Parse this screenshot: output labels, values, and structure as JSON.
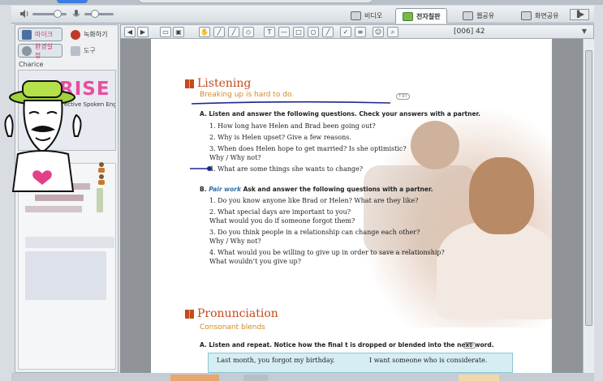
{
  "toolbar_tabs": [
    {
      "label": "비디오",
      "icon": "video-icon",
      "active": false
    },
    {
      "label": "전자칠판",
      "icon": "pen-icon",
      "active": true
    },
    {
      "label": "웹공유",
      "icon": "web-icon",
      "active": false
    },
    {
      "label": "화면공유",
      "icon": "monitor-icon",
      "active": false
    }
  ],
  "left_tools": {
    "mic": "마이크",
    "record": "녹화하기",
    "settings": "환경설정",
    "tools": "도구"
  },
  "section_title": "Charice",
  "video_logo": {
    "text": "RISE",
    "sub": "ective Spoken Englis"
  },
  "doc_toolbar": {
    "page_label": "[006] 42"
  },
  "document": {
    "listening": {
      "title": "Listening",
      "subtitle": "Breaking up is hard to do.",
      "cd": "T-97",
      "A_heading": "A.  Listen and answer the following questions. Check your answers with a partner.",
      "A_items": [
        "1. How long have Helen and Brad been going out?",
        "2. Why is Helen upset? Give a few reasons.",
        "3. When does Helen hope to get married? Is she optimistic?",
        "    Why / Why not?",
        "4. What are some things she wants to change?"
      ],
      "B_label": "B.",
      "B_pair": "Pair work",
      "B_heading": "Ask and answer the following questions with a partner.",
      "B_items": [
        "1. Do you know anyone like Brad or Helen? What are they like?",
        "2. What special days are important to you?",
        "    What would you do if someone forgot them?",
        "3. Do you think people in a relationship can change each other?",
        "    Why / Why not?",
        "4. What would you be willing to give up in order to save a relationship?",
        "    What wouldn’t you give up?"
      ]
    },
    "pronunciation": {
      "title": "Pronunciation",
      "subtitle": "Consonant blends",
      "cd": "T-98",
      "A_heading": "A.  Listen and repeat. Notice how the final t is dropped or blended into the next word.",
      "box_left": "Last month, you forgot my birthday.",
      "box_right": "I want someone who is considerate."
    }
  },
  "colors": {
    "heading": "#c44b1c",
    "subhead": "#d28a1f",
    "pair_work": "#2b6fa8",
    "active_tab": "#fbfcfd"
  }
}
